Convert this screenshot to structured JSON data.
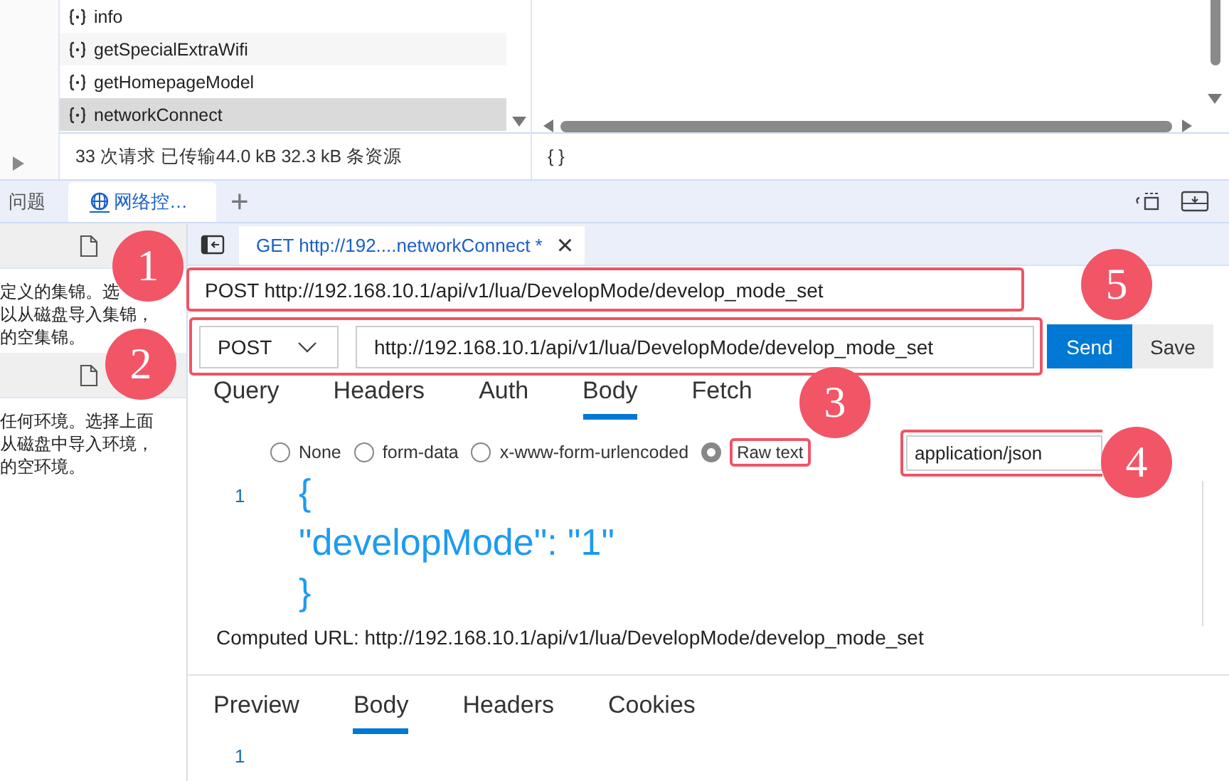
{
  "network_list": {
    "rows": [
      {
        "name": "info",
        "selected": false
      },
      {
        "name": "getSpecialExtraWifi",
        "selected": false
      },
      {
        "name": "getHomepageModel",
        "selected": false
      },
      {
        "name": "networkConnect",
        "selected": true
      }
    ]
  },
  "status_bar": {
    "summary": "33 次请求   已传输44.0 kB   32.3 kB 条资源",
    "preview": "{ }"
  },
  "panel_tabs": [
    {
      "label": "问题",
      "selected": false
    },
    {
      "label": "网络控…",
      "selected": true
    }
  ],
  "add_tab": "+",
  "sidebar": {
    "sections": [
      {
        "lines": [
          "定义的集锦。选",
          "以从磁盘导入集锦，",
          "的空集锦。"
        ]
      },
      {
        "lines": [
          "任何环境。选择上面",
          "从磁盘中导入环境，",
          "的空环境。"
        ]
      }
    ]
  },
  "request_tab": {
    "title": "GET http://192....networkConnect *",
    "close": "×"
  },
  "request_line": "POST http://192.168.10.1/api/v1/lua/DevelopMode/develop_mode_set",
  "method": "POST",
  "url": "http://192.168.10.1/api/v1/lua/DevelopMode/develop_mode_set",
  "buttons": [
    {
      "label": "Send",
      "kind": "primary"
    },
    {
      "label": "Save",
      "kind": "secondary"
    }
  ],
  "request_tabs": [
    {
      "label": "Query",
      "selected": false
    },
    {
      "label": "Headers",
      "selected": false
    },
    {
      "label": "Auth",
      "selected": false
    },
    {
      "label": "Body",
      "selected": true
    },
    {
      "label": "Fetch",
      "selected": false
    }
  ],
  "body_types": [
    {
      "label": "None",
      "selected": false
    },
    {
      "label": "form-data",
      "selected": false
    },
    {
      "label": "x-www-form-urlencoded",
      "selected": false
    },
    {
      "label": "Raw text",
      "selected": true
    }
  ],
  "content_type": "application/json",
  "editor": {
    "line_number": "1",
    "code_lines": [
      "{",
      "\"developMode\": \"1\"",
      "}"
    ]
  },
  "computed_url": "Computed URL: http://192.168.10.1/api/v1/lua/DevelopMode/develop_mode_set",
  "response_tabs": [
    {
      "label": "Preview",
      "selected": false
    },
    {
      "label": "Body",
      "selected": true
    },
    {
      "label": "Headers",
      "selected": false
    },
    {
      "label": "Cookies",
      "selected": false
    }
  ],
  "response_editor": {
    "line_number": "1"
  },
  "annotations": [
    {
      "label": "1"
    },
    {
      "label": "2"
    },
    {
      "label": "3"
    },
    {
      "label": "4"
    },
    {
      "label": "5"
    }
  ]
}
